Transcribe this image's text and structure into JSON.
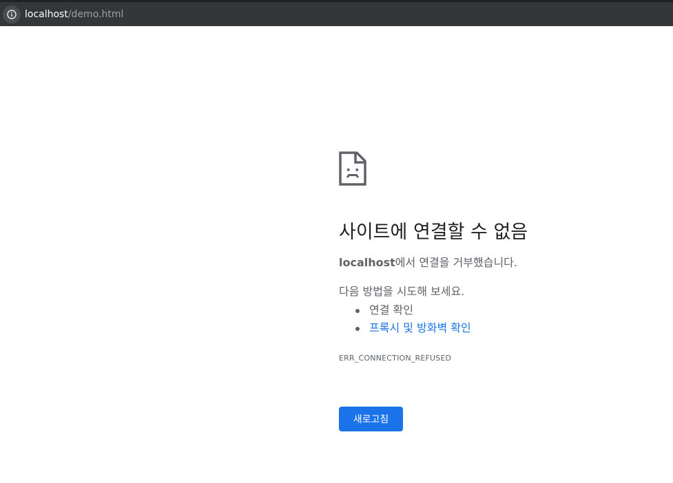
{
  "browser": {
    "url_host": "localhost",
    "url_path": "/demo.html",
    "site_info_icon": "info-icon"
  },
  "error_page": {
    "icon": "sad-page-icon",
    "title": "사이트에 연결할 수 없음",
    "description_host": "localhost",
    "description_rest": "에서 연결을 거부했습니다.",
    "try_text": "다음 방법을 시도해 보세요.",
    "suggestions": [
      {
        "label": "연결 확인",
        "is_link": false
      },
      {
        "label": "프록시 및 방화벽 확인",
        "is_link": true
      }
    ],
    "error_code": "ERR_CONNECTION_REFUSED",
    "reload_label": "새로고침"
  },
  "colors": {
    "toolbar": "#35363a",
    "link": "#1a73e8",
    "button": "#1a73e8",
    "text_secondary": "#5f6368"
  }
}
